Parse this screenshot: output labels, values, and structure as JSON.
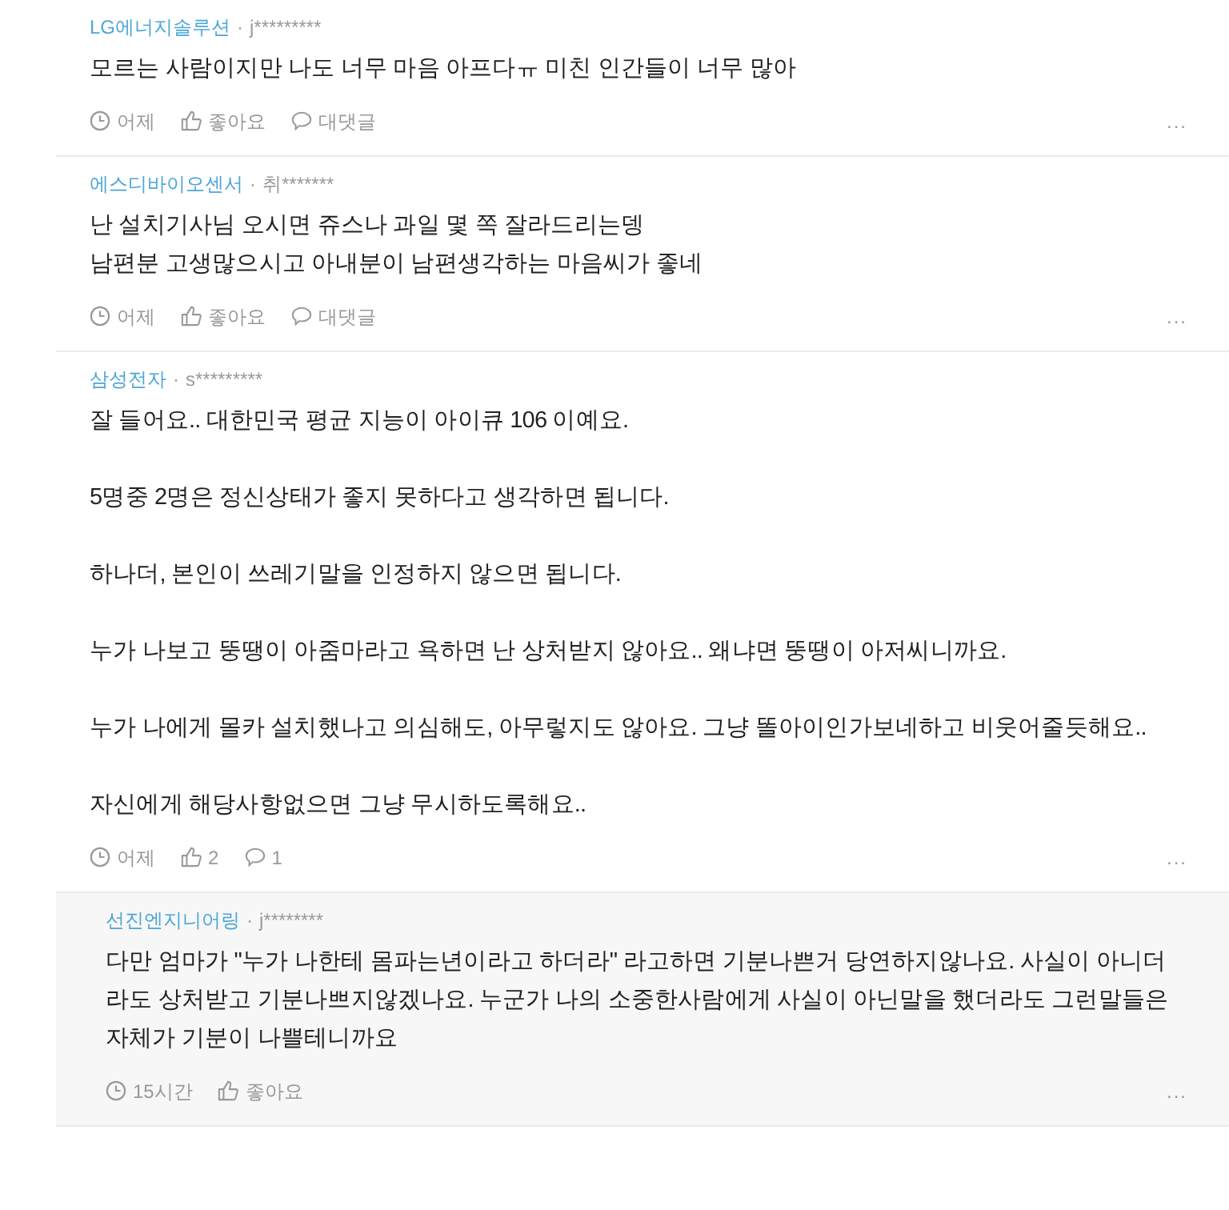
{
  "comments": [
    {
      "kind": "comment",
      "company": "LG에너지솔루션",
      "separator": "·",
      "user": "j*********",
      "lines": [
        "모르는 사람이지만 나도 너무 마음 아프다ㅠ 미친 인간들이 너무 많아"
      ],
      "time": "어제",
      "likes": "좋아요",
      "replies": "대댓글",
      "more": "..."
    },
    {
      "kind": "comment",
      "company": "에스디바이오센서",
      "separator": "·",
      "user": "취*******",
      "lines": [
        "난 설치기사님 오시면 쥬스나 과일 몇 쪽 잘라드리는뎅",
        "남편분 고생많으시고 아내분이 남편생각하는 마음씨가 좋네"
      ],
      "time": "어제",
      "likes": "좋아요",
      "replies": "대댓글",
      "more": "..."
    },
    {
      "kind": "comment",
      "company": "삼성전자",
      "separator": "·",
      "user": "s*********",
      "paragraphs": [
        "잘 들어요.. 대한민국 평균 지능이 아이큐 106 이예요.",
        "5명중 2명은 정신상태가 좋지 못하다고 생각하면 됩니다.",
        "하나더, 본인이 쓰레기말을 인정하지 않으면 됩니다.",
        "누가 나보고 뚱땡이 아줌마라고 욕하면 난 상처받지 않아요.. 왜냐면 뚱땡이 아저씨니까요.",
        "누가 나에게 몰카 설치했나고 의심해도, 아무렇지도 않아요. 그냥 똘아이인가보네하고 비웃어줄듯해요..",
        "자신에게 해당사항없으면 그냥 무시하도록해요.."
      ],
      "time": "어제",
      "likes": "2",
      "replies": "1",
      "more": "..."
    },
    {
      "kind": "reply",
      "company": "선진엔지니어링",
      "separator": "·",
      "user": "j********",
      "lines": [
        "다만 엄마가 \"누가 나한테 몸파는년이라고 하더라\" 라고하면 기분나쁜거 당연하지않나요. 사실이 아니더",
        "라도 상처받고 기분나쁘지않겠나요. 누군가 나의 소중한사람에게 사실이 아닌말을 했더라도 그런말들은",
        "자체가 기분이 나쁠테니까요"
      ],
      "time": "15시간",
      "likes": "좋아요",
      "more": "..."
    }
  ]
}
